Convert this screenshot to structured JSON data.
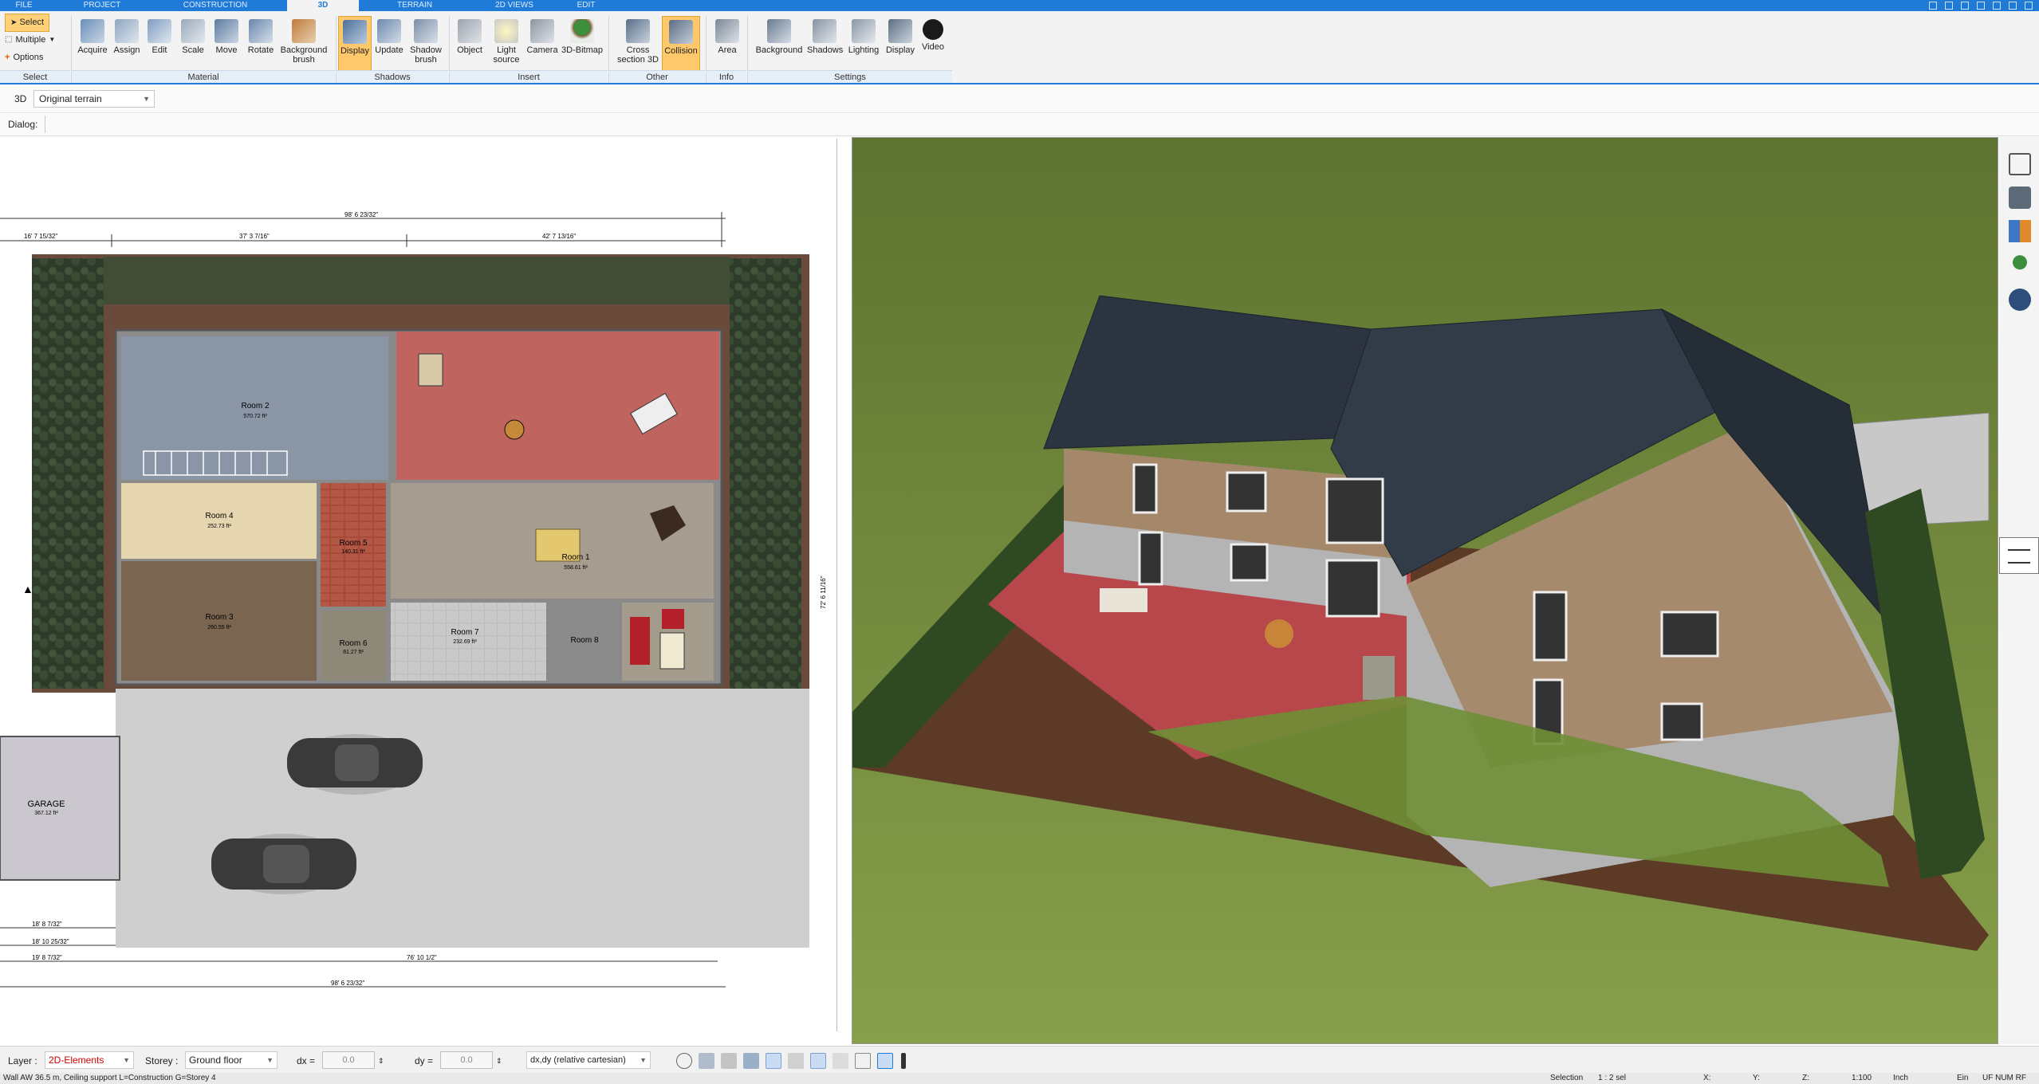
{
  "menu_tabs": [
    "FILE",
    "PROJECT",
    "CONSTRUCTION",
    "3D",
    "TERRAIN",
    "2D VIEWS",
    "EDIT"
  ],
  "ribbon": {
    "select": {
      "select_label": "Select",
      "multiple_label": "Multiple",
      "options_label": "Options",
      "group": "Select"
    },
    "material": {
      "buttons": [
        "Acquire",
        "Assign",
        "Edit",
        "Scale",
        "Move",
        "Rotate",
        "Background brush"
      ],
      "group": "Material"
    },
    "shadows": {
      "buttons": [
        "Display",
        "Update",
        "Shadow brush"
      ],
      "group": "Shadows"
    },
    "insert": {
      "buttons": [
        "Object",
        "Light source",
        "Camera",
        "3D-Bitmap"
      ],
      "group": "Insert"
    },
    "other": {
      "buttons": [
        "Cross section 3D",
        "Collision"
      ],
      "group": "Other"
    },
    "info": {
      "buttons": [
        "Area"
      ],
      "group": "Info"
    },
    "settings": {
      "buttons": [
        "Background",
        "Shadows",
        "Lighting",
        "Display",
        "Video"
      ],
      "group": "Settings"
    }
  },
  "subbar": {
    "mode_label": "3D",
    "terrain_select": "Original terrain"
  },
  "dialog_label": "Dialog:",
  "plan": {
    "rooms": [
      {
        "name": "Room 2",
        "area": "570.72 ft²"
      },
      {
        "name": "Room 4",
        "area": "252.73 ft²"
      },
      {
        "name": "Room 3",
        "area": "260.55 ft²"
      },
      {
        "name": "Room 5",
        "area": "140.31 ft²"
      },
      {
        "name": "Room 1",
        "area": "558.61 ft²"
      },
      {
        "name": "Room 6",
        "area": "81.27 ft²"
      },
      {
        "name": "Room 7",
        "area": "232.69 ft²"
      },
      {
        "name": "Room 8",
        "area": "..."
      },
      {
        "name": "GARAGE",
        "area": "367.12 ft²"
      }
    ],
    "dims": {
      "top_total": "98' 6 23/32\"",
      "top_left": "16' 7 15/32\"",
      "top_mid": "37' 3 7/16\"",
      "top_right": "42' 7 13/16\"",
      "bottom_total": "98' 6 23/32\"",
      "bottom_row": "76' 10 1/2\"",
      "bottom_left1": "18' 8 7/32\"",
      "bottom_left2": "18' 10 25/32\"",
      "bottom_left3": "19' 8 7/32\"",
      "right_dim": "72' 6 11/16\""
    }
  },
  "bottombar": {
    "layer_label": "Layer :",
    "layer_value": "2D-Elements",
    "storey_label": "Storey :",
    "storey_value": "Ground floor",
    "dx_label": "dx =",
    "dx_value": "0.0",
    "dy_label": "dy =",
    "dy_value": "0.0",
    "coord_mode": "dx,dy (relative cartesian)"
  },
  "status": {
    "left": "Wall AW 36.5 m, Ceiling support L=Construction G=Storey 4",
    "selection": "Selection",
    "selection_count": "1 : 2 sel",
    "x_label": "X:",
    "y_label": "Y:",
    "z_label": "Z:",
    "scale": "1:100",
    "unit": "Inch",
    "ein": "Ein",
    "flags": "UF NUM RF"
  },
  "colors": {
    "accent": "#1f7ad8",
    "highlight": "#ffc86b",
    "grass": "#6f8a3c",
    "roof": "#2b3440",
    "patio": "#b8474c"
  }
}
